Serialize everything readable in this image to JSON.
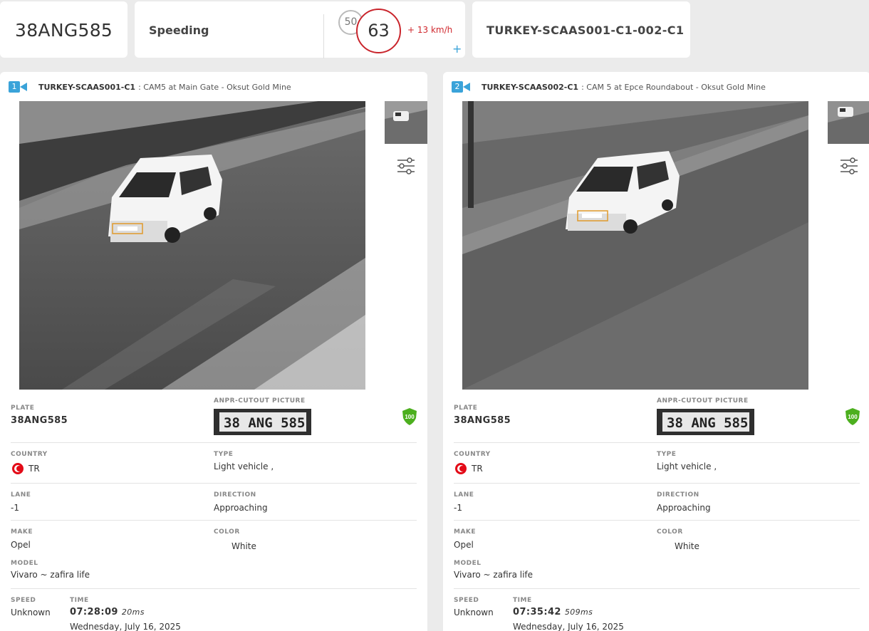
{
  "header": {
    "plate": "38ANG585",
    "event_type": "Speeding",
    "speed_limit": "50",
    "measured_speed": "63",
    "overspeed": "+ 13 km/h",
    "add_label": "+",
    "camera_id": "TURKEY-SCAAS001-C1-002-C1"
  },
  "colors": {
    "accent": "#3aa3d9",
    "alert": "#c9252c",
    "confidence": "#4caf1e"
  },
  "panels": [
    {
      "index": "1",
      "camera_name": "TURKEY-SCAAS001-C1",
      "location": ": CAM5 at Main Gate - Oksut Gold Mine",
      "labels": {
        "plate": "PLATE",
        "anpr": "ANPR-CUTOUT PICTURE",
        "country": "COUNTRY",
        "type": "TYPE",
        "lane": "LANE",
        "direction": "DIRECTION",
        "make": "MAKE",
        "color": "COLOR",
        "model": "MODEL",
        "speed": "SPEED",
        "time": "TIME"
      },
      "plate": "38ANG585",
      "anpr_text": "38 ANG 585",
      "confidence": "100",
      "country": "TR",
      "type": "Light vehicle ,",
      "lane": "-1",
      "direction": "Approaching",
      "make": "Opel",
      "color": "White",
      "model": "Vivaro ~ zafira life",
      "speed": "Unknown",
      "time": "07:28:09",
      "time_ms": "20ms",
      "date": "Wednesday, July 16, 2025"
    },
    {
      "index": "2",
      "camera_name": "TURKEY-SCAAS002-C1",
      "location": ": CAM 5 at Epce Roundabout - Oksut Gold Mine",
      "labels": {
        "plate": "PLATE",
        "anpr": "ANPR-CUTOUT PICTURE",
        "country": "COUNTRY",
        "type": "TYPE",
        "lane": "LANE",
        "direction": "DIRECTION",
        "make": "MAKE",
        "color": "COLOR",
        "model": "MODEL",
        "speed": "SPEED",
        "time": "TIME"
      },
      "plate": "38ANG585",
      "anpr_text": "38 ANG 585",
      "confidence": "100",
      "country": "TR",
      "type": "Light vehicle ,",
      "lane": "-1",
      "direction": "Approaching",
      "make": "Opel",
      "color": "White",
      "model": "Vivaro ~ zafira life",
      "speed": "Unknown",
      "time": "07:35:42",
      "time_ms": "509ms",
      "date": "Wednesday, July 16, 2025"
    }
  ]
}
